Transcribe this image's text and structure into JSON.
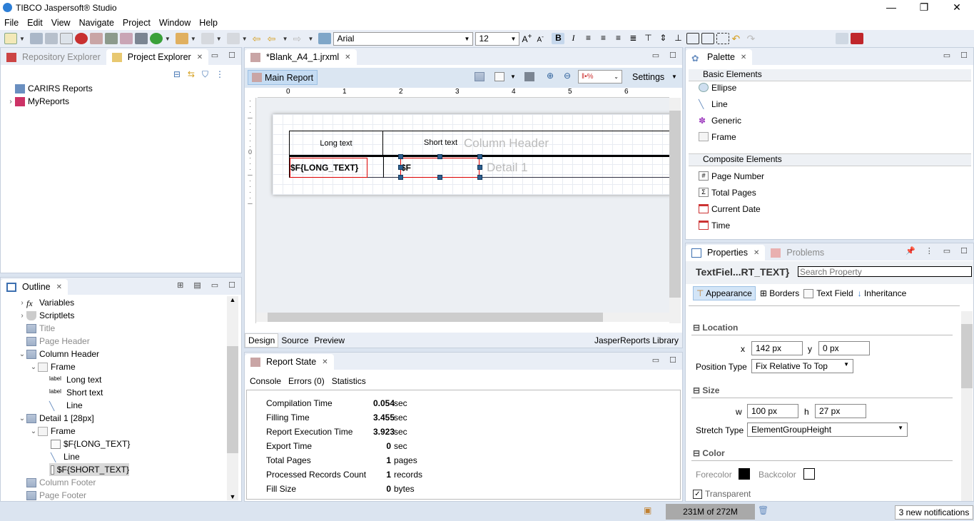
{
  "window": {
    "title": "TIBCO Jaspersoft® Studio",
    "minimize": "—",
    "maximize": "❐",
    "close": "✕"
  },
  "menu": [
    "File",
    "Edit",
    "View",
    "Navigate",
    "Project",
    "Window",
    "Help"
  ],
  "toolbar": {
    "font": "Arial",
    "font_size": "12"
  },
  "left_panel": {
    "tabs": [
      "Repository Explorer",
      "Project Explorer"
    ],
    "items": [
      "CARIRS Reports",
      "MyReports"
    ]
  },
  "outline": {
    "title": "Outline",
    "items": [
      {
        "label": "Variables",
        "state": "collapsed",
        "grey": false
      },
      {
        "label": "Scriptlets",
        "state": "collapsed",
        "grey": false
      },
      {
        "label": "Title",
        "grey": true
      },
      {
        "label": "Page Header",
        "grey": true
      },
      {
        "label": "Column Header",
        "state": "expanded",
        "grey": false
      },
      {
        "label": "Frame",
        "state": "expanded"
      },
      {
        "label": "Long text"
      },
      {
        "label": "Short text"
      },
      {
        "label": "Line"
      },
      {
        "label": "Detail 1 [28px]",
        "state": "expanded"
      },
      {
        "label": "Frame",
        "state": "expanded"
      },
      {
        "label": "$F{LONG_TEXT}"
      },
      {
        "label": "Line"
      },
      {
        "label": "$F{SHORT_TEXT}",
        "selected": true
      },
      {
        "label": "Column Footer",
        "grey": true
      },
      {
        "label": "Page Footer",
        "grey": true
      }
    ],
    "label_icon_text": "label"
  },
  "editor": {
    "tab": "*Blank_A4_1.jrxml",
    "main_report": "Main Report",
    "settings": "Settings",
    "ruler": [
      "0",
      "1",
      "2",
      "3",
      "4",
      "5",
      "6"
    ],
    "design": {
      "header_long": "Long text",
      "header_short": "Short text",
      "band_column_header": "Column Header",
      "field_long": "$F{LONG_TEXT}",
      "field_short": "$F",
      "band_detail": "Detail 1"
    },
    "bottom_tabs": [
      "Design",
      "Source",
      "Preview"
    ],
    "library": "JasperReports Library"
  },
  "report_state": {
    "title": "Report State",
    "tabs": [
      "Console",
      "Errors (0)",
      "Statistics"
    ],
    "rows": [
      {
        "label": "Compilation Time",
        "value": "0.054",
        "unit": "sec"
      },
      {
        "label": "Filling Time",
        "value": "3.455",
        "unit": "sec"
      },
      {
        "label": "Report Execution Time",
        "value": "3.923",
        "unit": "sec"
      },
      {
        "label": "Export Time",
        "value": "0",
        "unit": "sec"
      },
      {
        "label": "Total Pages",
        "value": "1",
        "unit": "pages"
      },
      {
        "label": "Processed Records Count",
        "value": "1",
        "unit": "records"
      },
      {
        "label": "Fill Size",
        "value": "0",
        "unit": "bytes"
      }
    ]
  },
  "palette": {
    "title": "Palette",
    "basic": "Basic Elements",
    "basic_items": [
      "Ellipse",
      "Line",
      "Generic",
      "Frame"
    ],
    "composite": "Composite Elements",
    "composite_items": [
      "Page Number",
      "Total Pages",
      "Current Date",
      "Time"
    ]
  },
  "properties": {
    "tabs": [
      "Properties",
      "Problems"
    ],
    "element": "TextFiel...RT_TEXT}",
    "search_placeholder": "Search Property",
    "subtabs": [
      "Appearance",
      "Borders",
      "Text Field",
      "Inheritance"
    ],
    "location": "Location",
    "x_label": "x",
    "x": "142 px",
    "y_label": "y",
    "y": "0 px",
    "position_type_label": "Position Type",
    "position_type": "Fix Relative To Top",
    "size": "Size",
    "w_label": "w",
    "w": "100 px",
    "h_label": "h",
    "h": "27 px",
    "stretch_label": "Stretch Type",
    "stretch": "ElementGroupHeight",
    "color": "Color",
    "forecolor": "Forecolor",
    "backcolor": "Backcolor",
    "forecolor_value": "#000000",
    "backcolor_value": "#ffffff",
    "transparent": "Transparent",
    "transparent_checked": true
  },
  "status": {
    "memory": "231M of 272M",
    "notifications": "3 new notifications"
  }
}
